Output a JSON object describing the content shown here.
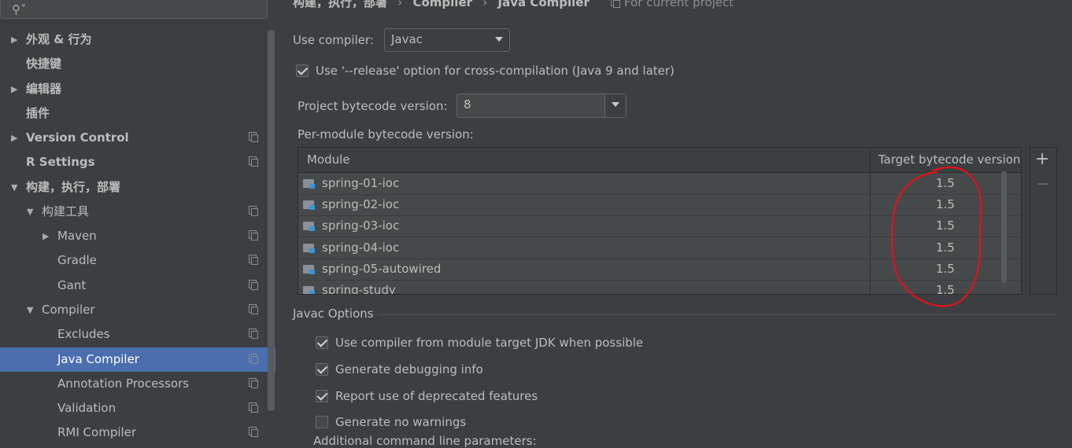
{
  "search": {
    "placeholder": "",
    "icon": "search-icon"
  },
  "sidebar": {
    "items": [
      {
        "label": "外观 & 行为",
        "expanded": false,
        "bold": true
      },
      {
        "label": "快捷键",
        "bold": true
      },
      {
        "label": "编辑器",
        "expanded": false,
        "bold": true
      },
      {
        "label": "插件",
        "bold": true
      },
      {
        "label": "Version Control",
        "expanded": false,
        "bold": true
      },
      {
        "label": "R Settings",
        "bold": true
      },
      {
        "label": "构建，执行，部署",
        "expanded": true,
        "bold": true
      },
      {
        "label": "构建工具",
        "expanded": true
      },
      {
        "label": "Maven",
        "expanded": false
      },
      {
        "label": "Gradle"
      },
      {
        "label": "Gant"
      },
      {
        "label": "Compiler",
        "expanded": true
      },
      {
        "label": "Excludes"
      },
      {
        "label": "Java Compiler",
        "selected": true
      },
      {
        "label": "Annotation Processors"
      },
      {
        "label": "Validation"
      },
      {
        "label": "RMI Compiler"
      }
    ]
  },
  "header": {
    "breadcrumb": [
      "构建，执行，部署",
      "Compiler",
      "Java Compiler"
    ],
    "separator": "›",
    "scope_note": "For current project"
  },
  "compiler": {
    "use_compiler_label": "Use compiler:",
    "use_compiler_value": "Javac",
    "release_option_label": "Use '--release' option for cross-compilation (Java 9 and later)",
    "release_option_checked": true,
    "project_bytecode_label": "Project bytecode version:",
    "project_bytecode_value": "8",
    "per_module_label": "Per-module bytecode version:"
  },
  "module_table": {
    "columns": [
      "Module",
      "Target bytecode version"
    ],
    "rows": [
      {
        "module": "spring-01-ioc",
        "target": "1.5"
      },
      {
        "module": "spring-02-ioc",
        "target": "1.5"
      },
      {
        "module": "spring-03-ioc",
        "target": "1.5"
      },
      {
        "module": "spring-04-ioc",
        "target": "1.5"
      },
      {
        "module": "spring-05-autowired",
        "target": "1.5"
      },
      {
        "module": "spring-study",
        "target": "1.5"
      }
    ],
    "add_label": "+",
    "remove_label": "−"
  },
  "javac_options": {
    "title": "Javac Options",
    "options": [
      {
        "label": "Use compiler from module target JDK when possible",
        "checked": true
      },
      {
        "label": "Generate debugging info",
        "checked": true
      },
      {
        "label": "Report use of deprecated features",
        "checked": true
      },
      {
        "label": "Generate no warnings",
        "checked": false
      }
    ],
    "additional_params_label": "Additional command line parameters:"
  },
  "colors": {
    "background": "#3c3f41",
    "selection": "#4b6eaf",
    "annotation_red": "#e3121c"
  }
}
